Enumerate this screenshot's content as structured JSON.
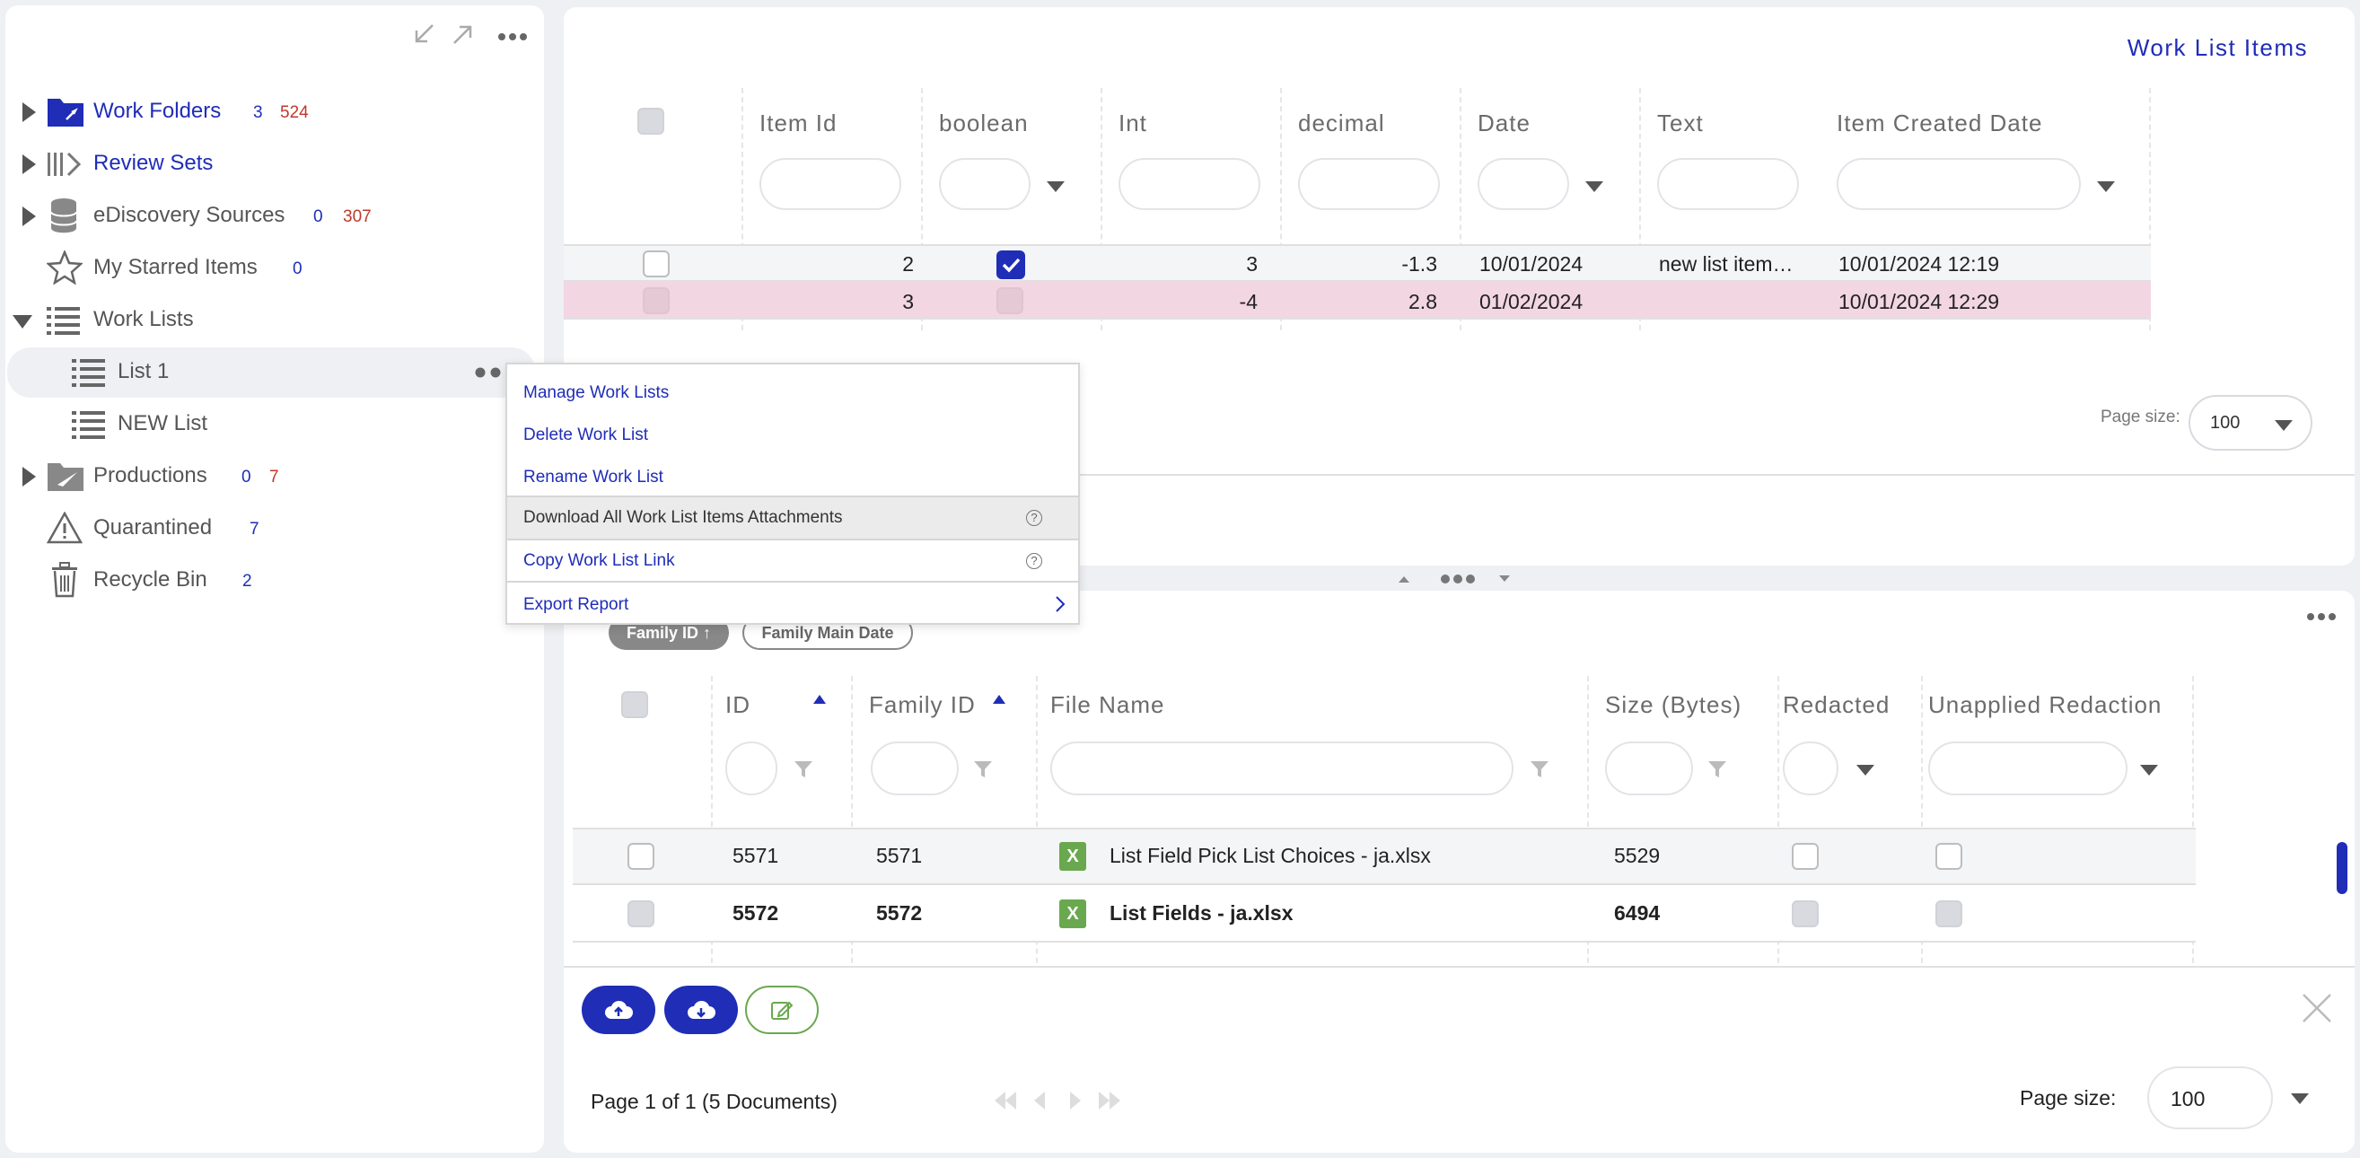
{
  "sidebar": {
    "items": [
      {
        "label": "Work Folders",
        "count1": "3",
        "count2": "524"
      },
      {
        "label": "Review Sets"
      },
      {
        "label": "eDiscovery Sources",
        "count1": "0",
        "count2": "307"
      },
      {
        "label": "My Starred Items",
        "count1": "0"
      },
      {
        "label": "Work Lists"
      },
      {
        "label": "List 1"
      },
      {
        "label": "NEW List"
      },
      {
        "label": "Productions",
        "count1": "0",
        "count2": "7"
      },
      {
        "label": "Quarantined",
        "count1": "7"
      },
      {
        "label": "Recycle Bin",
        "count1": "2"
      }
    ]
  },
  "work_list_items": {
    "title": "Work List Items",
    "columns": [
      "Item Id",
      "boolean",
      "Int",
      "decimal",
      "Date",
      "Text",
      "Item Created Date"
    ],
    "rows": [
      {
        "item_id": "2",
        "boolean": true,
        "int": "3",
        "decimal": "-1.3",
        "date": "10/01/2024",
        "text": "new list item…",
        "created": "10/01/2024 12:19"
      },
      {
        "item_id": "3",
        "boolean": false,
        "int": "-4",
        "decimal": "2.8",
        "date": "01/02/2024",
        "text": "",
        "created": "10/01/2024 12:29"
      }
    ],
    "page_size_label": "Page size:",
    "page_size": "100"
  },
  "context_menu": {
    "items": [
      {
        "label": "Manage Work Lists"
      },
      {
        "label": "Delete Work List"
      },
      {
        "label": "Rename Work List"
      },
      {
        "label": "Download All Work List Items Attachments",
        "help": "?"
      },
      {
        "label": "Copy Work List Link",
        "help": "?"
      },
      {
        "label": "Export Report"
      }
    ]
  },
  "documents": {
    "sort_chips": [
      "Family ID ↑",
      "Family Main Date"
    ],
    "columns": [
      "ID",
      "Family ID",
      "File Name",
      "Size (Bytes)",
      "Redacted",
      "Unapplied Redaction"
    ],
    "rows": [
      {
        "id": "5571",
        "family_id": "5571",
        "file_name": "List Field Pick List Choices - ja.xlsx",
        "size": "5529"
      },
      {
        "id": "5572",
        "family_id": "5572",
        "file_name": "List Fields - ja.xlsx",
        "size": "6494"
      }
    ],
    "file_icon_letter": "X",
    "pagination_text": "Page 1 of 1 (5 Documents)",
    "page_size_label": "Page size:",
    "page_size": "100"
  },
  "colors": {
    "accent": "#1f2db7",
    "highlight_row": "#f2d6e2",
    "excel_green": "#6aa84f"
  }
}
